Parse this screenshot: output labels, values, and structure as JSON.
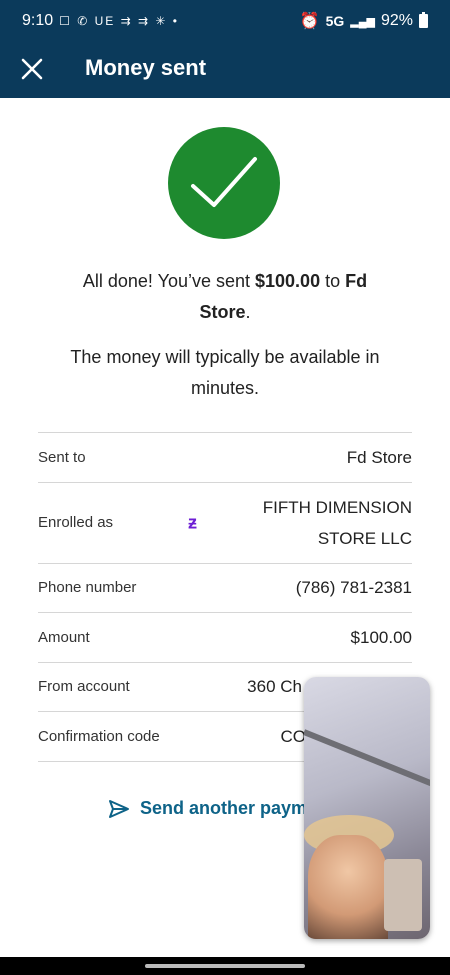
{
  "status_bar": {
    "time": "9:10",
    "left_icons": "☐ ✆ UE ⇉ ⇉ ✳ •",
    "network": "5G",
    "battery": "92%"
  },
  "header": {
    "title": "Money sent",
    "close_icon": "close-icon"
  },
  "confirmation": {
    "msg1_prefix": "All done! You’ve sent ",
    "amount": "$100.00",
    "msg1_mid": " to ",
    "recipient": "Fd Store",
    "msg1_suffix": ".",
    "msg2": "The money will typically be available in minutes."
  },
  "details": [
    {
      "label": "Sent to",
      "value": "Fd Store"
    },
    {
      "label": "Enrolled as",
      "value": "FIFTH DIMENSION STORE LLC",
      "icon": "zelle-icon",
      "icon_glyph": "ƶ"
    },
    {
      "label": "Phone number",
      "value": "(786) 781-2381"
    },
    {
      "label": "Amount",
      "value": "$100.00"
    },
    {
      "label": "From account",
      "value": "360 Ch"
    },
    {
      "label": "Confirmation code",
      "value": "CO"
    }
  ],
  "actions": {
    "send_another": "Send another paym"
  },
  "colors": {
    "header_bg": "#0b3a5b",
    "success_green": "#1e8a2f",
    "link_blue": "#0e6388",
    "zelle_purple": "#6d1ed4"
  }
}
